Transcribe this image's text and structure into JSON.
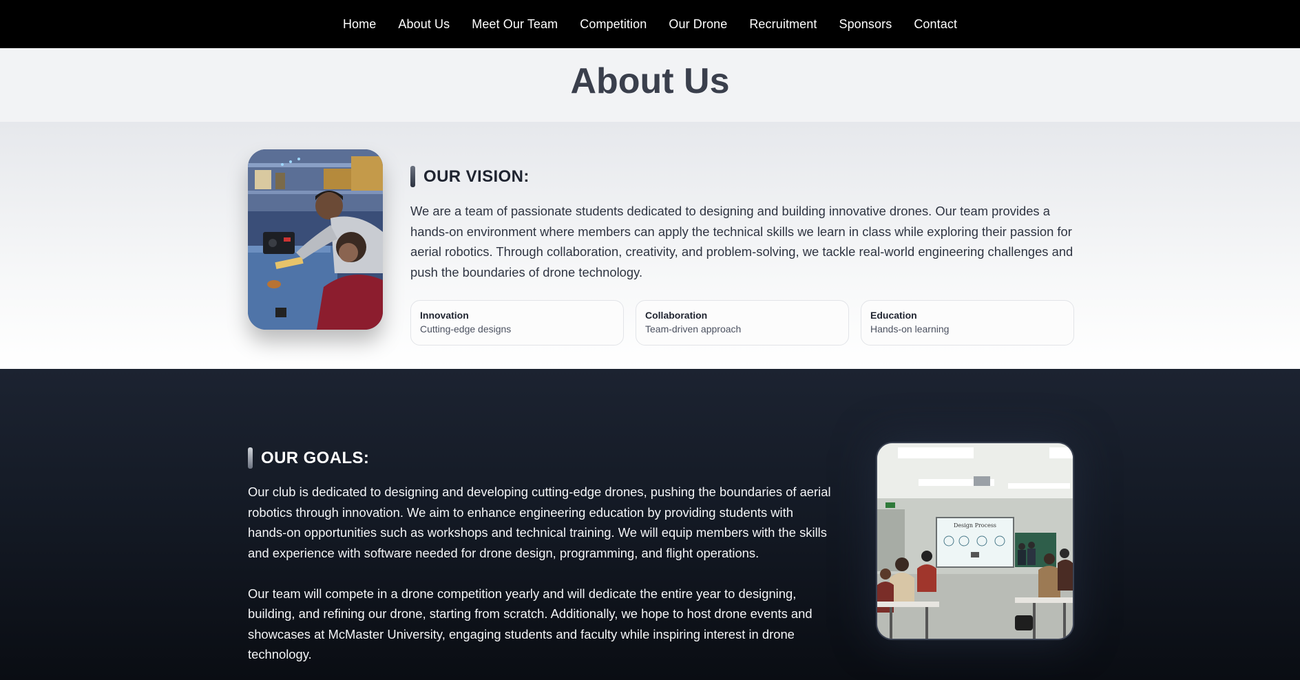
{
  "nav": {
    "items": [
      "Home",
      "About Us",
      "Meet Our Team",
      "Competition",
      "Our Drone",
      "Recruitment",
      "Sponsors",
      "Contact"
    ]
  },
  "hero": {
    "title": "About Us"
  },
  "vision": {
    "heading": "OUR VISION:",
    "text": "We are a team of passionate students dedicated to designing and building innovative drones. Our team provides a hands-on environment where members can apply the technical skills we learn in class while exploring their passion for aerial robotics. Through collaboration, creativity, and problem-solving, we tackle real-world engineering challenges and push the boundaries of drone technology.",
    "cards": [
      {
        "title": "Innovation",
        "subtitle": "Cutting-edge designs"
      },
      {
        "title": "Collaboration",
        "subtitle": "Team-driven approach"
      },
      {
        "title": "Education",
        "subtitle": "Hands-on learning"
      }
    ]
  },
  "goals": {
    "heading": "OUR GOALS:",
    "paragraphs": [
      "Our club is dedicated to designing and developing cutting-edge drones, pushing the boundaries of aerial robotics through innovation. We aim to enhance engineering education by providing students with hands-on opportunities such as workshops and technical training. We will equip members with the skills and experience with software needed for drone design, programming, and flight operations.",
      "Our team will compete in a drone competition yearly and will dedicate the entire year to designing, building, and refining our drone, starting from scratch. Additionally, we hope to host drone events and showcases at McMaster University, engaging students and faculty while inspiring interest in drone technology."
    ],
    "photo_slide_title": "Design Process"
  }
}
